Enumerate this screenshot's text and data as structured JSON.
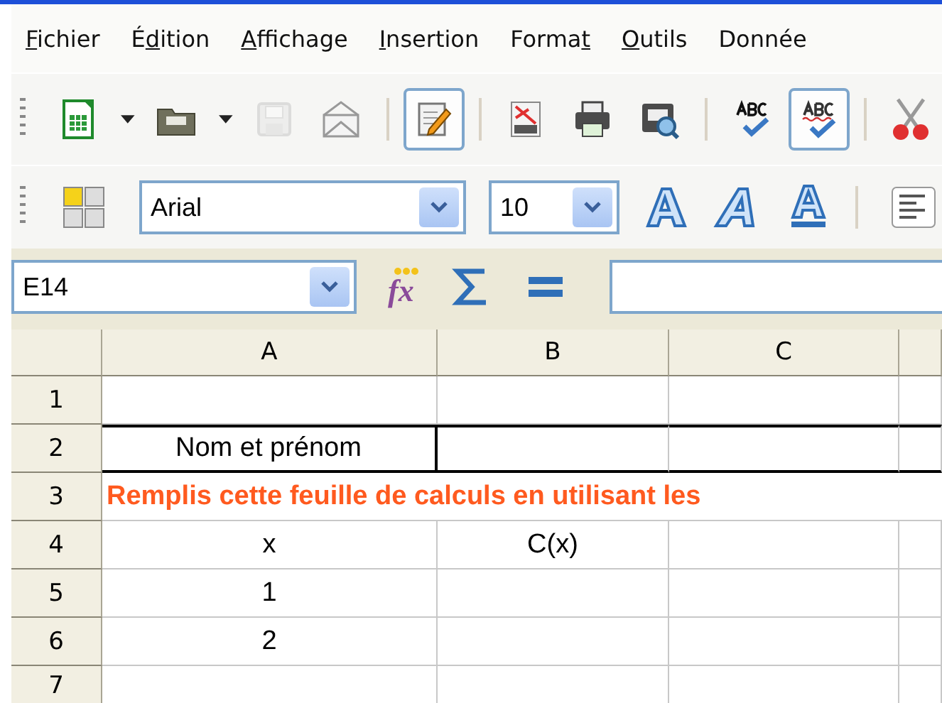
{
  "menu": [
    {
      "key": "F",
      "rest": "ichier"
    },
    {
      "lead": "É",
      "key": "d",
      "rest": "ition"
    },
    {
      "key": "A",
      "rest": "ffichage"
    },
    {
      "key": "I",
      "rest": "nsertion"
    },
    {
      "lead": "Forma",
      "key": "t"
    },
    {
      "key": "O",
      "rest": "utils"
    },
    {
      "lead": "Donnée"
    }
  ],
  "standard_toolbar": [
    [
      {
        "kind": "new",
        "dropdown": true,
        "pressed": false,
        "disabled": false
      },
      {
        "kind": "open",
        "dropdown": true,
        "pressed": false,
        "disabled": false
      },
      {
        "kind": "save",
        "dropdown": false,
        "pressed": false,
        "disabled": true
      },
      {
        "kind": "email",
        "dropdown": false,
        "pressed": false,
        "disabled": false
      }
    ],
    [
      {
        "kind": "edit",
        "dropdown": false,
        "pressed": true,
        "disabled": false
      }
    ],
    [
      {
        "kind": "pdf",
        "dropdown": false,
        "pressed": false,
        "disabled": false
      },
      {
        "kind": "print",
        "dropdown": false,
        "pressed": false,
        "disabled": false
      },
      {
        "kind": "preview",
        "dropdown": false,
        "pressed": false,
        "disabled": false
      }
    ],
    [
      {
        "kind": "spellcheck",
        "dropdown": false,
        "pressed": false,
        "disabled": false
      },
      {
        "kind": "autospell",
        "dropdown": false,
        "pressed": true,
        "disabled": false
      }
    ],
    [
      {
        "kind": "cut",
        "dropdown": false,
        "pressed": false,
        "disabled": false
      }
    ]
  ],
  "formatting_toolbar": {
    "font_name": "Arial",
    "font_size": "10"
  },
  "formula_bar": {
    "name_box": "E14",
    "function_label": "fx"
  },
  "sheet": {
    "columns": [
      "A",
      "B",
      "C"
    ],
    "rows": [
      {
        "header": "1",
        "kind": "normal",
        "cells": {}
      },
      {
        "header": "2",
        "kind": "bordered",
        "cells": {
          "A": "Nom et prénom"
        }
      },
      {
        "header": "3",
        "kind": "banner",
        "cells": {
          "A": "Remplis cette feuille de calculs en utilisant les"
        }
      },
      {
        "header": "4",
        "kind": "normal",
        "cells": {
          "A": "x",
          "B": "C(x)"
        }
      },
      {
        "header": "5",
        "kind": "normal",
        "cells": {
          "A": "1"
        }
      },
      {
        "header": "6",
        "kind": "normal",
        "cells": {
          "A": "2"
        }
      },
      {
        "header": "7",
        "kind": "normal",
        "cells": {}
      }
    ]
  }
}
